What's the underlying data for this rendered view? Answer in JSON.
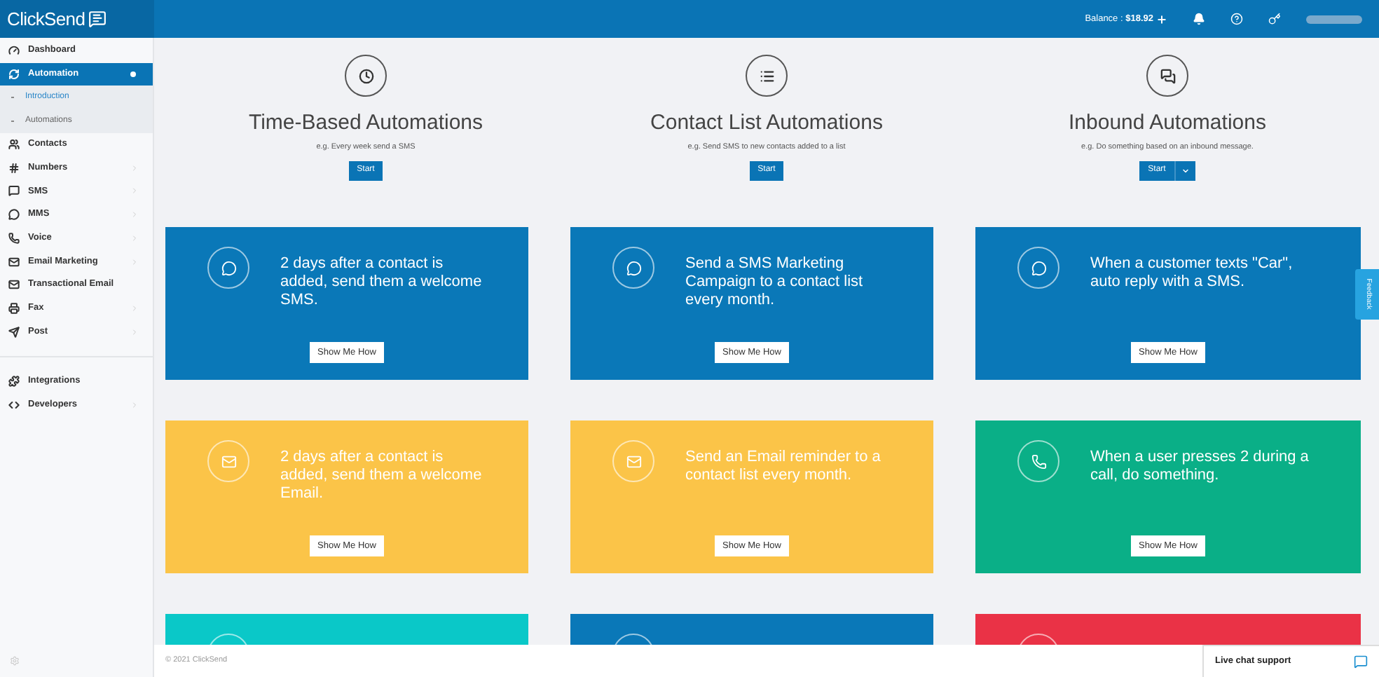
{
  "header": {
    "logo": "ClickSend",
    "balance": "Balance : **$18.92**"
  },
  "sidebar": {
    "items": [
      {
        "label": "Dashboard",
        "selected": false,
        "expandable": false
      },
      {
        "label": "Automation",
        "selected": true,
        "expandable": true,
        "expanded": true,
        "children": [
          {
            "label": "Introduction",
            "selected": true
          },
          {
            "label": "Automations",
            "selected": false
          }
        ]
      },
      {
        "label": "Contacts",
        "selected": false,
        "expandable": false
      },
      {
        "label": "Numbers",
        "selected": false,
        "expandable": true,
        "expanded": false
      },
      {
        "label": "SMS",
        "selected": false,
        "expandable": true,
        "expanded": false
      },
      {
        "label": "MMS",
        "selected": false,
        "expandable": true,
        "expanded": false
      },
      {
        "label": "Voice",
        "selected": false,
        "expandable": true,
        "expanded": false
      },
      {
        "label": "Email Marketing",
        "selected": false,
        "expandable": true,
        "expanded": false
      },
      {
        "label": "Transactional Email",
        "selected": false,
        "expandable": false
      },
      {
        "label": "Fax",
        "selected": false,
        "expandable": true,
        "expanded": false
      },
      {
        "label": "Post",
        "selected": false,
        "expandable": true,
        "expanded": false
      }
    ],
    "bottom_items": [
      {
        "label": "Integrations",
        "selected": false,
        "expandable": false
      },
      {
        "label": "Developers",
        "selected": false,
        "expandable": true,
        "expanded": false
      }
    ]
  },
  "automation_types": [
    {
      "kind": "time",
      "title": "Time-Based Automations",
      "example": "e.g. Every week send a SMS",
      "button": "Start",
      "dropdown": false
    },
    {
      "kind": "list",
      "title": "Contact List Automations",
      "example": "e.g. Send SMS to new contacts added to a list",
      "button": "Start",
      "dropdown": false
    },
    {
      "kind": "inbound",
      "title": "Inbound Automations",
      "example": "e.g. Do something based on an inbound message.",
      "button": "Start",
      "dropdown": true
    }
  ],
  "cards": [
    {
      "kind": "sms",
      "color": "#0a78b8",
      "text": "2 days after a contact is added, send them a welcome SMS.",
      "button": "Show Me How"
    },
    {
      "kind": "sms",
      "color": "#0a78b8",
      "text": "Send a SMS Marketing Campaign to a contact list every month.",
      "button": "Show Me How"
    },
    {
      "kind": "sms",
      "color": "#0a78b8",
      "text": "When a customer texts \"Car\", auto reply with a SMS.",
      "button": "Show Me How"
    },
    {
      "kind": "email",
      "color": "#fbc448",
      "text": "2 days after a contact is added, send them a welcome Email.",
      "button": "Show Me How"
    },
    {
      "kind": "email",
      "color": "#fbc448",
      "text": "Send an Email reminder to a contact list every month.",
      "button": "Show Me How"
    },
    {
      "kind": "voice",
      "color": "#0aaf87",
      "text": "When a user presses 2 during a call, do something.",
      "button": "Show Me How"
    },
    {
      "kind": "partial",
      "color": "#0ac8c8"
    },
    {
      "kind": "partial",
      "color": "#0a78b8"
    },
    {
      "kind": "partial",
      "color": "#ea3246"
    }
  ],
  "feedback_tab": "Feedback",
  "footer": {
    "copyright": "© 2021 ClickSend",
    "live_chat": "Live chat support"
  }
}
